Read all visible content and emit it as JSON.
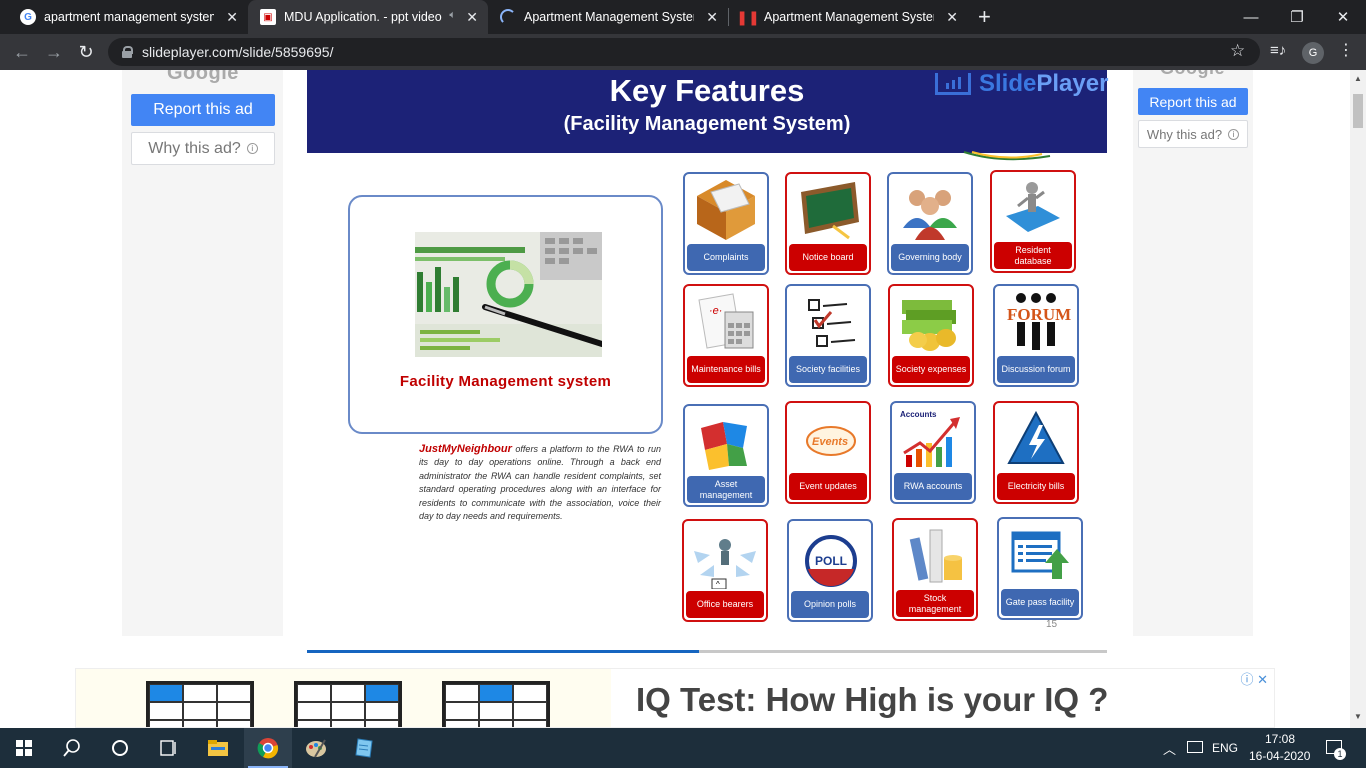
{
  "browser": {
    "tabs": [
      {
        "title": "apartment management system |",
        "favicon": "google-icon",
        "active": false
      },
      {
        "title": "MDU Application. - ppt video",
        "favicon": "slideplayer-icon",
        "active": true,
        "audio": true
      },
      {
        "title": "Apartment Management System",
        "favicon": "loading-spinner-icon",
        "active": false
      },
      {
        "title": "Apartment Management System",
        "favicon": "pause-bars-icon",
        "active": false
      }
    ],
    "new_tab": "+",
    "window_controls": {
      "minimize": "—",
      "maximize": "❐",
      "close": "✕"
    },
    "url": "slideplayer.com/slide/5859695/",
    "profile_initial": "G"
  },
  "ads": {
    "left": {
      "brand": "Google",
      "report": "Report this ad",
      "why": "Why this ad?"
    },
    "right": {
      "brand": "Google",
      "report": "Report this ad",
      "why": "Why this ad?"
    },
    "bottom": {
      "headline": "IQ Test: How High is your IQ ?"
    }
  },
  "slide": {
    "title": "Key Features",
    "subtitle": "(Facility Management System)",
    "logo": {
      "part1": "Slide",
      "part2": "Player"
    },
    "photo_caption": "Facility Management system",
    "description_brand": "JustMyNeighbour",
    "description": " offers a platform to the RWA to run its day to day operations online. Through a back end administrator the RWA can handle resident complaints, set standard operating procedures along with an interface for residents to communicate with the association, voice their day to day needs and requirements.",
    "slide_number": "15",
    "progress_fraction": 0.49,
    "features": [
      {
        "label": "Complaints",
        "style": "blue",
        "icon": "envelope-box-icon"
      },
      {
        "label": "Notice board",
        "style": "red",
        "icon": "chalkboard-icon"
      },
      {
        "label": "Governing body",
        "style": "blue",
        "icon": "people-group-icon"
      },
      {
        "label": "Resident database",
        "style": "red",
        "icon": "puzzle-person-icon"
      },
      {
        "label": "Maintenance bills",
        "style": "red",
        "icon": "calculator-bill-icon"
      },
      {
        "label": "Society facilities",
        "style": "blue",
        "icon": "checklist-icon"
      },
      {
        "label": "Society expenses",
        "style": "red",
        "icon": "money-stack-icon"
      },
      {
        "label": "Discussion forum",
        "style": "blue",
        "icon": "forum-people-icon"
      },
      {
        "label": "Asset management",
        "style": "blue",
        "icon": "puzzle-pieces-icon"
      },
      {
        "label": "Event updates",
        "style": "red",
        "icon": "events-badge-icon",
        "badge": "Events"
      },
      {
        "label": "RWA accounts",
        "style": "blue",
        "icon": "accounts-chart-icon",
        "badge": "Accounts"
      },
      {
        "label": "Electricity bills",
        "style": "red",
        "icon": "electric-hazard-icon"
      },
      {
        "label": "Office bearers",
        "style": "red",
        "icon": "network-person-icon"
      },
      {
        "label": "Opinion polls",
        "style": "blue",
        "icon": "poll-button-icon",
        "badge": "POLL"
      },
      {
        "label": "Stock management",
        "style": "red",
        "icon": "stock-rolls-icon"
      },
      {
        "label": "Gate pass facility",
        "style": "blue",
        "icon": "gate-pass-window-icon"
      }
    ]
  },
  "taskbar": {
    "apps": [
      "windows-start-icon",
      "search-icon",
      "cortana-icon",
      "task-view-icon",
      "file-explorer-icon",
      "chrome-icon",
      "paint-icon",
      "notepad-icon"
    ],
    "language": "ENG",
    "time": "17:08",
    "date": "16-04-2020",
    "notification_count": "1"
  },
  "colors": {
    "slide_header": "#1c2277",
    "label_blue": "#3f68b1",
    "label_red": "#cc0000",
    "report_button": "#4285f4"
  }
}
